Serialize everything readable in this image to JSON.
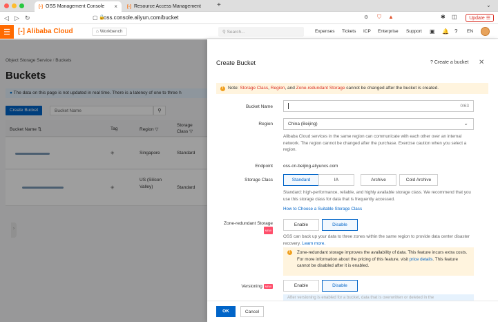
{
  "browser": {
    "tabs": [
      {
        "label": "OSS Management Console",
        "active": true
      },
      {
        "label": "Resource Access Management",
        "active": false
      }
    ],
    "url": "oss.console.aliyun.com/bucket",
    "update_label": "Update"
  },
  "header": {
    "logo": "Alibaba Cloud",
    "workbench": "Workbench",
    "search_placeholder": "Search...",
    "nav": [
      "Expenses",
      "Tickets",
      "ICP",
      "Enterprise",
      "Support"
    ],
    "lang": "EN"
  },
  "left": {
    "breadcrumb": [
      "Object Storage Service",
      "Buckets"
    ],
    "title": "Buckets",
    "notice": "The data on this page is not updated in real time. There is a latency of one to three h",
    "create_button": "Create Bucket",
    "filter_placeholder": "Bucket Name",
    "columns": [
      "Bucket Name",
      "Tag",
      "Region",
      "Storage Class"
    ],
    "rows": [
      {
        "region": "Singapore",
        "storage_class": "Standard"
      },
      {
        "region": "US (Silicon Valley)",
        "storage_class": "Standard"
      }
    ]
  },
  "panel": {
    "title": "Create Bucket",
    "help_link": "Create a bucket",
    "warning": {
      "prefix": "Note: ",
      "hl1": "Storage Class",
      "sep1": ", ",
      "hl2": "Region",
      "sep2": ", and ",
      "hl3": "Zone-redundant Storage",
      "suffix": " cannot be changed after the bucket is created."
    },
    "bucket_name": {
      "label": "Bucket Name",
      "value": "",
      "counter": "0/63"
    },
    "region": {
      "label": "Region",
      "value": "China (Beijing)",
      "help": "Alibaba Cloud services in the same region can communicate with each other over an internal network. The region cannot be changed after the purchase. Exercise caution when you select a region."
    },
    "endpoint": {
      "label": "Endpoint",
      "value": "oss-cn-beijing.aliyuncs.com"
    },
    "storage_class": {
      "label": "Storage Class",
      "options": [
        "Standard",
        "IA",
        "Archive",
        "Cold Archive"
      ],
      "selected": "Standard",
      "help": "Standard: high-performance, reliable, and highly available storage class. We recommend that you use this storage class for data that is frequently accessed.",
      "link": "How to Choose a Suitable Storage Class"
    },
    "zrs": {
      "label": "Zone-redundant Storage",
      "badge": "NEW",
      "options": [
        "Enable",
        "Disable"
      ],
      "selected": "Disable",
      "help": "OSS can back up your data to three zones within the same region to provide data center disaster recovery.",
      "help_link": "Learn more.",
      "note_a": "Zone-redundant storage improves the availability of data. This feature incurs extra costs. For more information about the pricing of this feature, visit ",
      "note_link1": "price",
      "note_link2": "details",
      "note_b": ". This feature cannot be disabled after it is enabled."
    },
    "versioning": {
      "label": "Versioning",
      "badge": "NEW",
      "options": [
        "Enable",
        "Disable"
      ],
      "selected": "Disable",
      "note": "After versioning is enabled for a bucket, data that is overwritten or deleted in the"
    },
    "ok_label": "OK",
    "cancel_label": "Cancel"
  }
}
